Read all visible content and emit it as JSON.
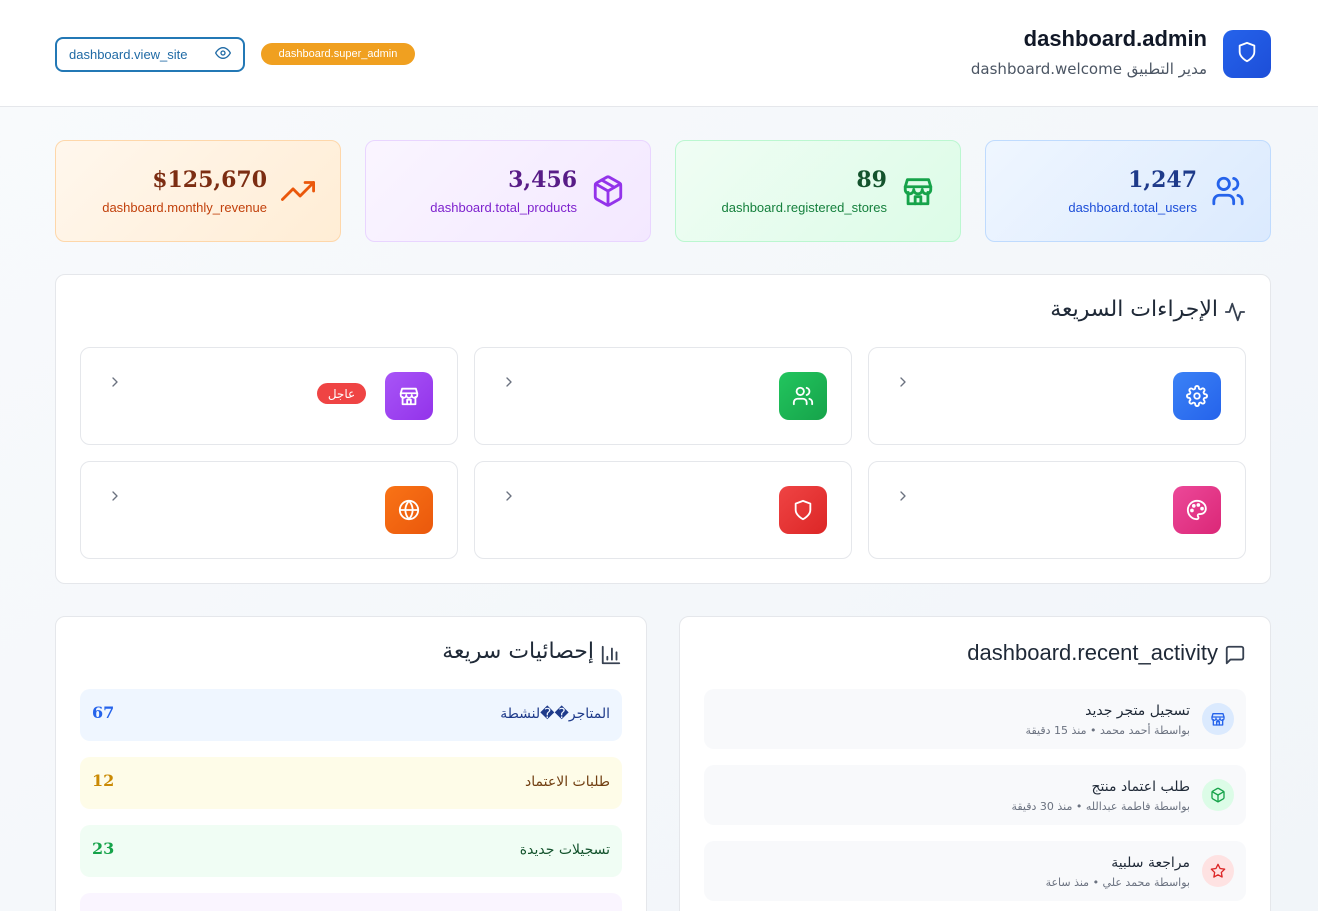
{
  "header": {
    "title": "dashboard.admin",
    "subtitle": "dashboard.welcome مدير التطبيق",
    "view_site_label": "dashboard.view_site",
    "role_badge": "dashboard.super_admin",
    "logo_icon": "shield-icon",
    "accent": "#2563eb"
  },
  "stats": [
    {
      "key": "users",
      "value": "1,247",
      "label": "dashboard.total_users",
      "icon": "users-icon",
      "color": "#2563eb"
    },
    {
      "key": "stores",
      "value": "89",
      "label": "dashboard.registered_stores",
      "icon": "store-icon",
      "color": "#16a34a"
    },
    {
      "key": "products",
      "value": "3,456",
      "label": "dashboard.total_products",
      "icon": "package-icon",
      "color": "#9333ea"
    },
    {
      "key": "revenue",
      "value": "$125,670",
      "label": "dashboard.monthly_revenue",
      "icon": "trending-up-icon",
      "color": "#ea580c"
    }
  ],
  "quick_actions": {
    "title": "الإجراءات السريعة",
    "icon": "activity-icon",
    "items": [
      {
        "icon": "settings-icon",
        "color": "#2563eb"
      },
      {
        "icon": "users-icon",
        "color": "#16a34a"
      },
      {
        "icon": "store-icon",
        "color": "#9333ea",
        "badge": "عاجل"
      },
      {
        "icon": "palette-icon",
        "color": "#db2777"
      },
      {
        "icon": "shield-icon",
        "color": "#dc2626"
      },
      {
        "icon": "globe-icon",
        "color": "#ea580c"
      }
    ]
  },
  "quick_stats": {
    "title": "إحصائيات سريعة",
    "icon": "bar-chart-icon",
    "items": [
      {
        "label": "المتاجر��لنشطة",
        "value": "67",
        "bg": "#eff6ff",
        "color": "#2563eb"
      },
      {
        "label": "طلبات الاعتماد",
        "value": "12",
        "bg": "#fefce8",
        "color": "#ca8a04"
      },
      {
        "label": "تسجيلات جديدة",
        "value": "23",
        "bg": "#f0fdf4",
        "color": "#16a34a"
      }
    ]
  },
  "recent_activity": {
    "title": "dashboard.recent_activity",
    "icon": "message-icon",
    "items": [
      {
        "title": "تسجيل متجر جديد",
        "meta": "بواسطة أحمد محمد • منذ 15 دقيقة",
        "icon": "store-icon",
        "bg": "#dbeafe",
        "color": "#2563eb"
      },
      {
        "title": "طلب اعتماد منتج",
        "meta": "بواسطة فاطمة عبدالله • منذ 30 دقيقة",
        "icon": "package-icon",
        "bg": "#dcfce7",
        "color": "#16a34a"
      },
      {
        "title": "مراجعة سلبية",
        "meta": "بواسطة محمد علي • منذ ساعة",
        "icon": "star-icon",
        "bg": "#fee2e2",
        "color": "#dc2626"
      }
    ]
  }
}
